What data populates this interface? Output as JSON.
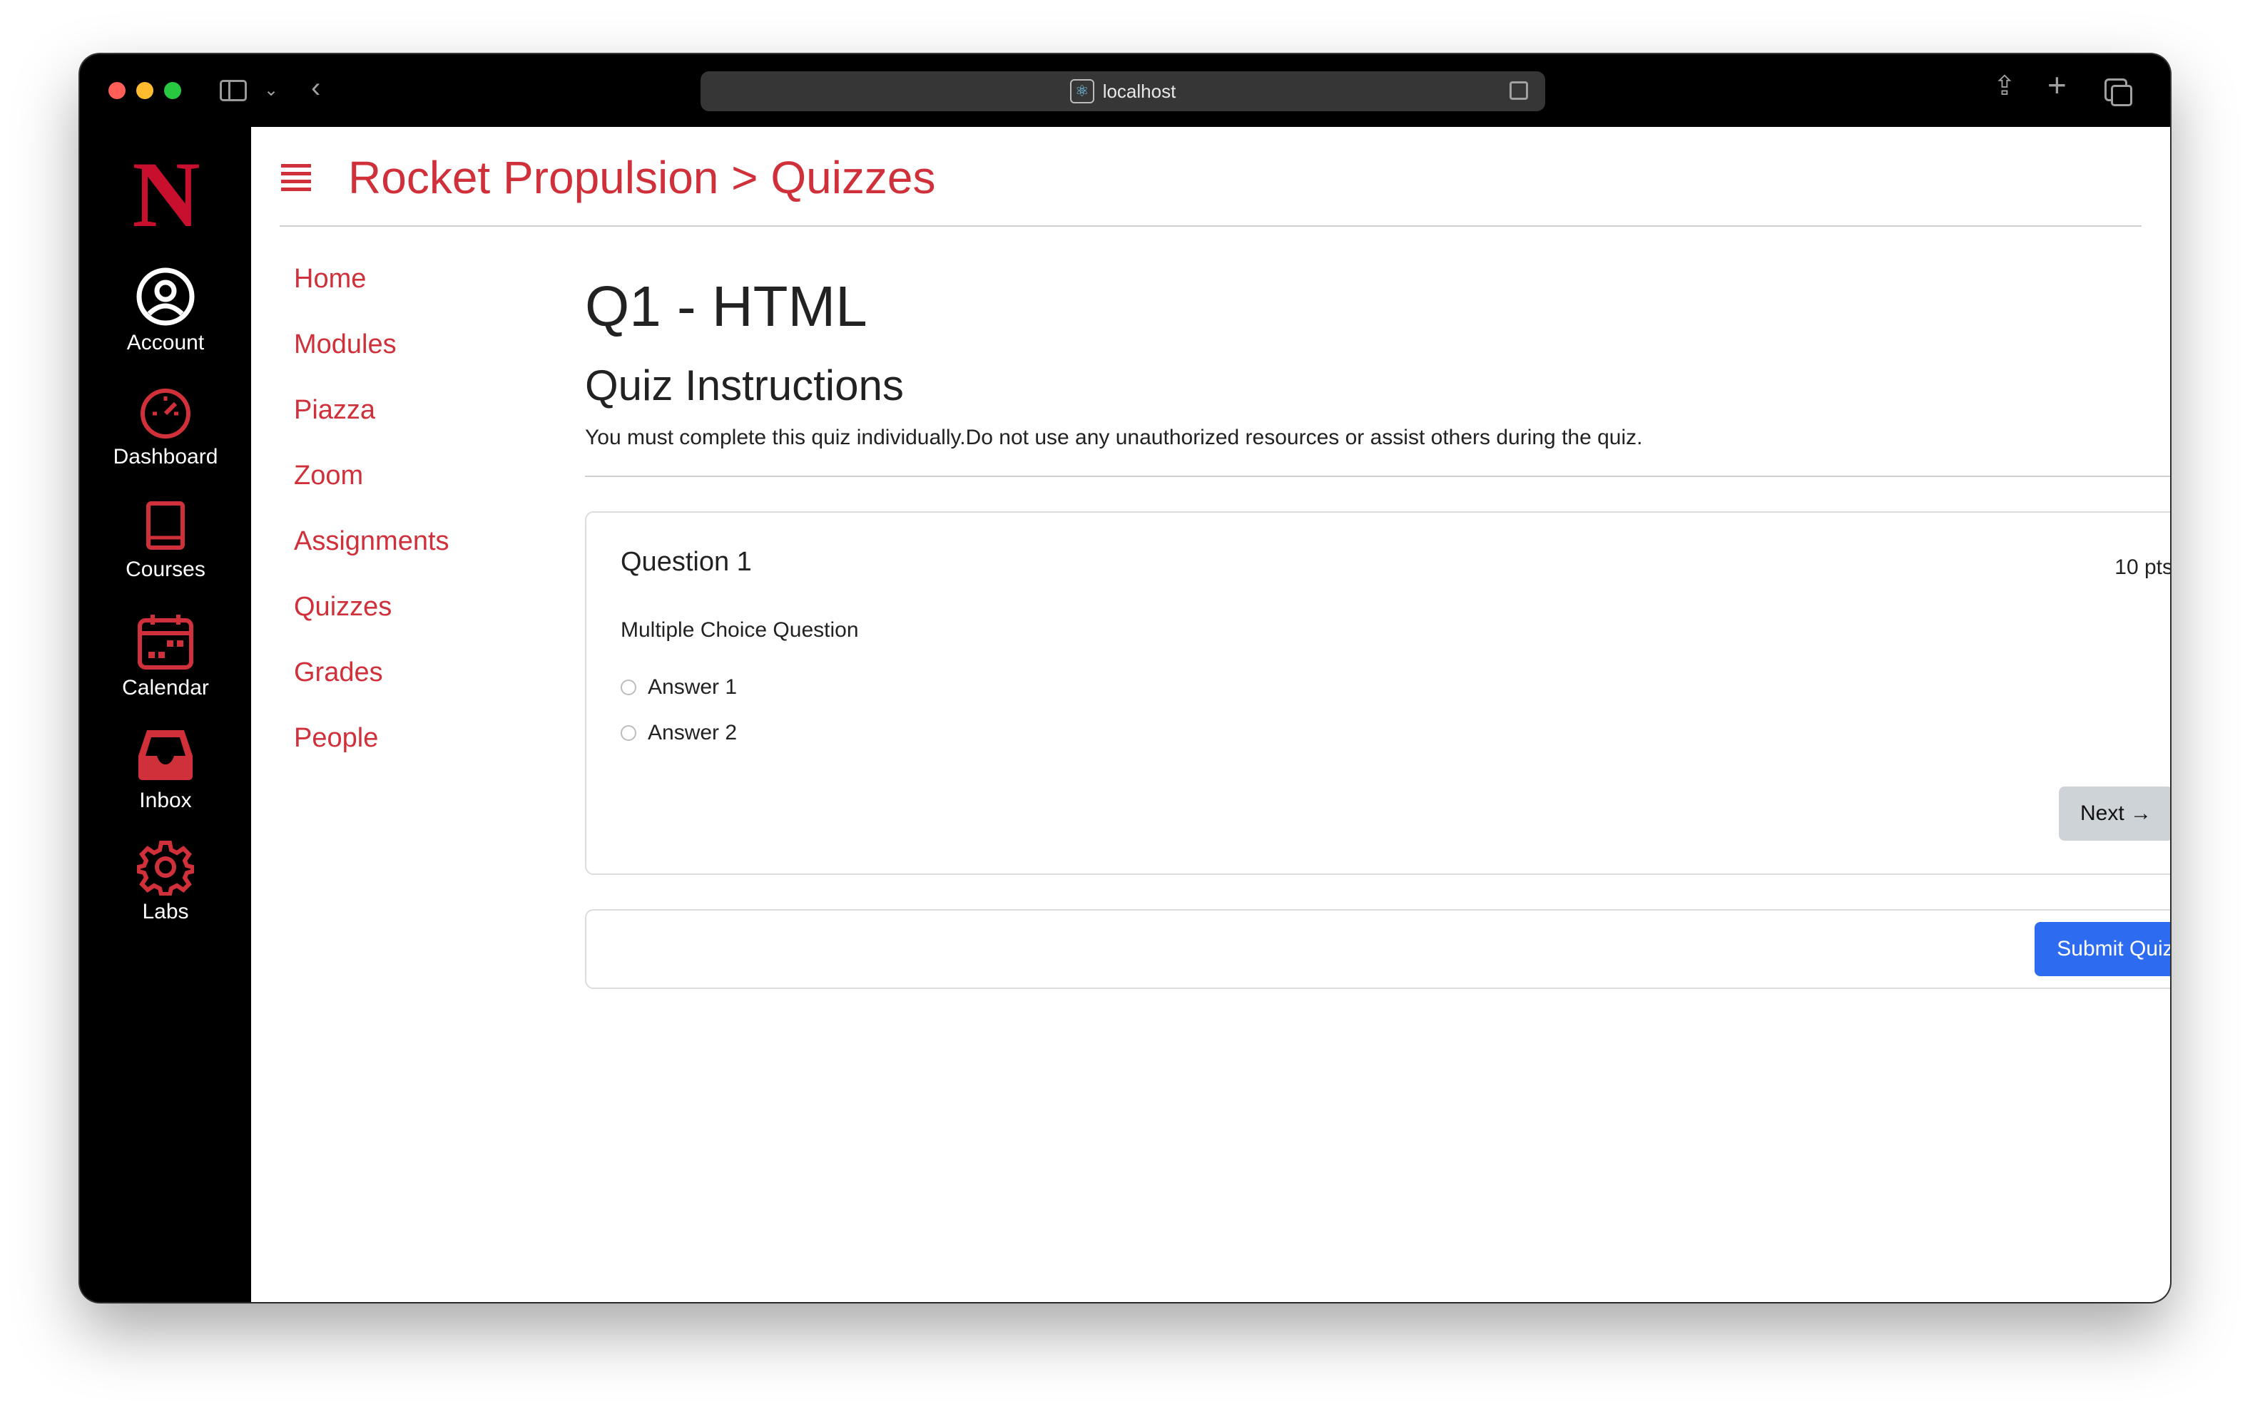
{
  "browser": {
    "url": "localhost"
  },
  "global_nav": {
    "items": [
      {
        "label": "Account",
        "icon": "user-circle-icon"
      },
      {
        "label": "Dashboard",
        "icon": "speedometer-icon"
      },
      {
        "label": "Courses",
        "icon": "book-icon"
      },
      {
        "label": "Calendar",
        "icon": "calendar-icon"
      },
      {
        "label": "Inbox",
        "icon": "inbox-icon"
      },
      {
        "label": "Labs",
        "icon": "gear-icon"
      }
    ],
    "accent_color": "#d0303a"
  },
  "breadcrumb": {
    "text": "Rocket Propulsion > Quizzes"
  },
  "course_nav": {
    "items": [
      "Home",
      "Modules",
      "Piazza",
      "Zoom",
      "Assignments",
      "Quizzes",
      "Grades",
      "People"
    ]
  },
  "quiz": {
    "title": "Q1 - HTML",
    "instructions_heading": "Quiz Instructions",
    "instructions_text": "You must complete this quiz individually.Do not use any unauthorized resources or assist others during the quiz.",
    "question": {
      "title": "Question 1",
      "points": "10 pts",
      "type": "Multiple Choice Question",
      "answers": [
        "Answer 1",
        "Answer 2"
      ]
    },
    "next_label": "Next →",
    "submit_label": "Submit Quiz"
  }
}
